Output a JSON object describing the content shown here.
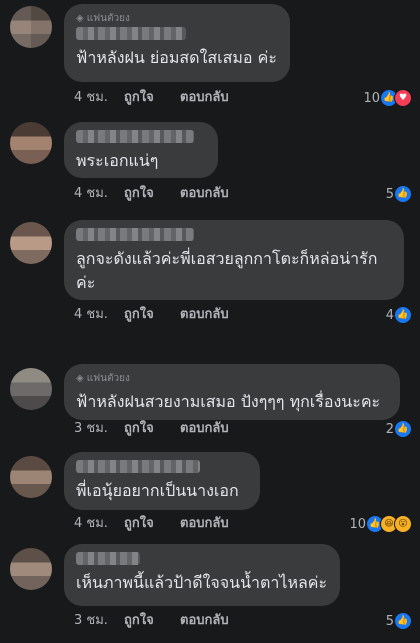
{
  "comments": [
    {
      "badge": "แฟนตัวยง",
      "text": "ฟ้าหลังฝน ย่อมสดใสเสมอ ค่ะ",
      "time": "4 ชม.",
      "like_label": "ถูกใจ",
      "reply_label": "ตอบกลับ",
      "reaction_count": "10",
      "reactions": [
        "like-icon",
        "love-icon"
      ]
    },
    {
      "badge": "",
      "text": "พระเอกแน่ๆ",
      "time": "4 ชม.",
      "like_label": "ถูกใจ",
      "reply_label": "ตอบกลับ",
      "reaction_count": "5",
      "reactions": [
        "like-icon"
      ]
    },
    {
      "badge": "",
      "text": "ลูกจะดังแล้วค่ะพี่เอสวยลูกกาโตะก็หล่อน่ารัก",
      "text2": "ค่ะ",
      "time": "4 ชม.",
      "like_label": "ถูกใจ",
      "reply_label": "ตอบกลับ",
      "reaction_count": "4",
      "reactions": [
        "like-icon"
      ]
    },
    {
      "badge": "แฟนตัวยง",
      "text": "ฟ้าหลังฝนสวยงามเสมอ ปังๆๆๆ ทุกเรื่องนะคะ",
      "time": "3 ชม.",
      "like_label": "ถูกใจ",
      "reply_label": "ตอบกลับ",
      "reaction_count": "2",
      "reactions": [
        "like-icon"
      ]
    },
    {
      "badge": "",
      "text": "พี่เอนุ้ยอยากเป็นนางเอก",
      "time": "4 ชม.",
      "like_label": "ถูกใจ",
      "reply_label": "ตอบกลับ",
      "reaction_count": "10",
      "reactions": [
        "like-icon",
        "haha-icon",
        "wow-icon"
      ]
    },
    {
      "badge": "",
      "text": "เห็นภาพนี้แล้วป้าดีใจจนน้ำตาไหลค่ะ",
      "time": "3 ชม.",
      "like_label": "ถูกใจ",
      "reply_label": "ตอบกลับ",
      "reaction_count": "5",
      "reactions": [
        "like-icon"
      ]
    }
  ],
  "reaction_glyphs": {
    "like": "👍",
    "love": "♥",
    "haha": "😆",
    "wow": "😮"
  },
  "colors": {
    "background": "#18191a",
    "bubble": "#3a3b3c",
    "text": "#e4e6eb",
    "secondary_text": "#b0b3b8",
    "like_blue": "#1877f2",
    "love_red": "#f33e58",
    "haha_yellow": "#f7b125"
  }
}
